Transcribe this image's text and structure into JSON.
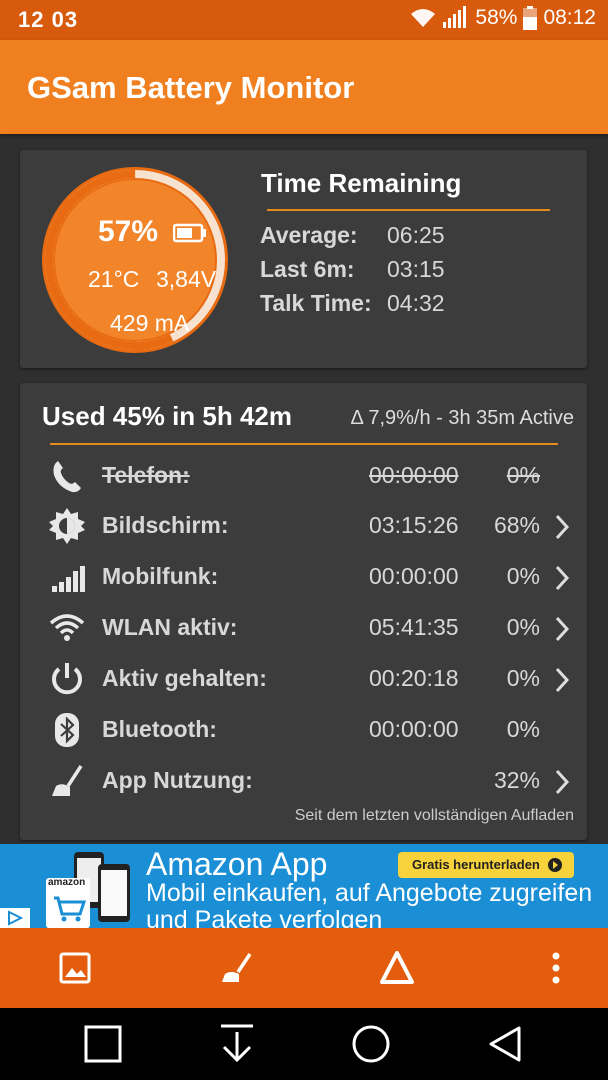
{
  "status_bar": {
    "time": "12 03",
    "battery": "58%",
    "clock": "08:12"
  },
  "app_bar": {
    "title": "GSam Battery Monitor"
  },
  "gauge": {
    "percent": "57%",
    "level": 0.57,
    "temperature": "21°C",
    "voltage": "3,84V",
    "current": "429 mA"
  },
  "time_remaining": {
    "title": "Time Remaining",
    "rows": [
      {
        "label": "Average:",
        "value": "06:25"
      },
      {
        "label": "Last 6m:",
        "value": "03:15"
      },
      {
        "label": "Talk Time:",
        "value": "04:32"
      }
    ]
  },
  "usage": {
    "title": "Used 45% in 5h 42m",
    "rate": "Δ 7,9%/h - 3h 35m Active",
    "rows": [
      {
        "icon": "phone-icon",
        "name": "Telefon:",
        "time": "00:00:00",
        "percent": "0%"
      },
      {
        "icon": "brightness-icon",
        "name": "Bildschirm:",
        "time": "03:15:26",
        "percent": "68%"
      },
      {
        "icon": "signal-icon",
        "name": "Mobilfunk:",
        "time": "00:00:00",
        "percent": "0%"
      },
      {
        "icon": "wifi-icon",
        "name": "WLAN aktiv:",
        "time": "05:41:35",
        "percent": "0%"
      },
      {
        "icon": "power-icon",
        "name": "Aktiv gehalten:",
        "time": "00:20:18",
        "percent": "0%"
      },
      {
        "icon": "bluetooth-icon",
        "name": "Bluetooth:",
        "time": "00:00:00",
        "percent": "0%"
      },
      {
        "icon": "broom-icon",
        "name": "App Nutzung:",
        "time": "",
        "percent": "32%"
      }
    ],
    "footnote": "Seit dem letzten vollständigen Aufladen"
  },
  "ad": {
    "brand": "Amazon App",
    "description": "Mobil einkaufen, auf Angebote zugreifen und Pakete verfolgen",
    "cta": "Gratis herunterladen",
    "logo_text": "amazon"
  },
  "toolbar": {
    "icons": [
      "image-icon",
      "broom-icon",
      "delta-icon",
      "more-vert-icon"
    ]
  },
  "nav": {
    "icons": [
      "recents-icon",
      "download-icon",
      "home-icon",
      "back-icon"
    ]
  },
  "colors": {
    "accent": "#f07f1f",
    "statusbar": "#d85a0c",
    "toolbar": "#e45d0f",
    "card": "#3c3c3c",
    "divider": "#e58b1a",
    "ad": "#1a8fd6"
  }
}
